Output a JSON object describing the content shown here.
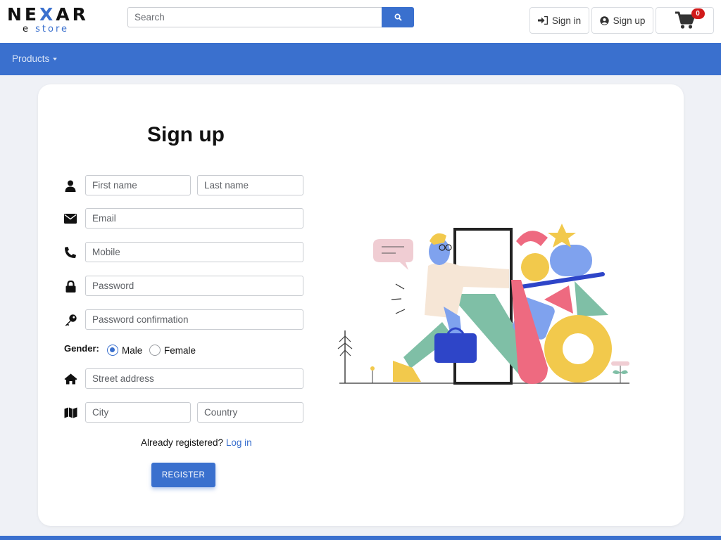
{
  "brand": {
    "name_prefix": "NE",
    "name_x": "X",
    "name_suffix": "AR",
    "sub_e": "e",
    "sub_store": "store"
  },
  "header": {
    "search_placeholder": "Search",
    "signin_label": "Sign in",
    "signup_label": "Sign up",
    "cart_count": "0"
  },
  "nav": {
    "products_label": "Products"
  },
  "form": {
    "title": "Sign up",
    "first_name_placeholder": "First name",
    "last_name_placeholder": "Last name",
    "email_placeholder": "Email",
    "mobile_placeholder": "Mobile",
    "password_placeholder": "Password",
    "password_confirmation_placeholder": "Password confirmation",
    "gender_label": "Gender:",
    "gender_options": [
      "Male",
      "Female"
    ],
    "gender_selected": "Male",
    "street_placeholder": "Street address",
    "city_placeholder": "City",
    "country_placeholder": "Country",
    "already_text": "Already registered?",
    "login_link": "Log in",
    "register_label": "REGISTER"
  },
  "colors": {
    "accent": "#3a70ce",
    "badge": "#d11a1a",
    "page_bg": "#eff1f6"
  },
  "icons": [
    "search-icon",
    "sign-in-icon",
    "user-circle-icon",
    "cart-icon",
    "user-icon",
    "envelope-icon",
    "phone-icon",
    "lock-icon",
    "key-icon",
    "home-icon",
    "map-icon"
  ]
}
